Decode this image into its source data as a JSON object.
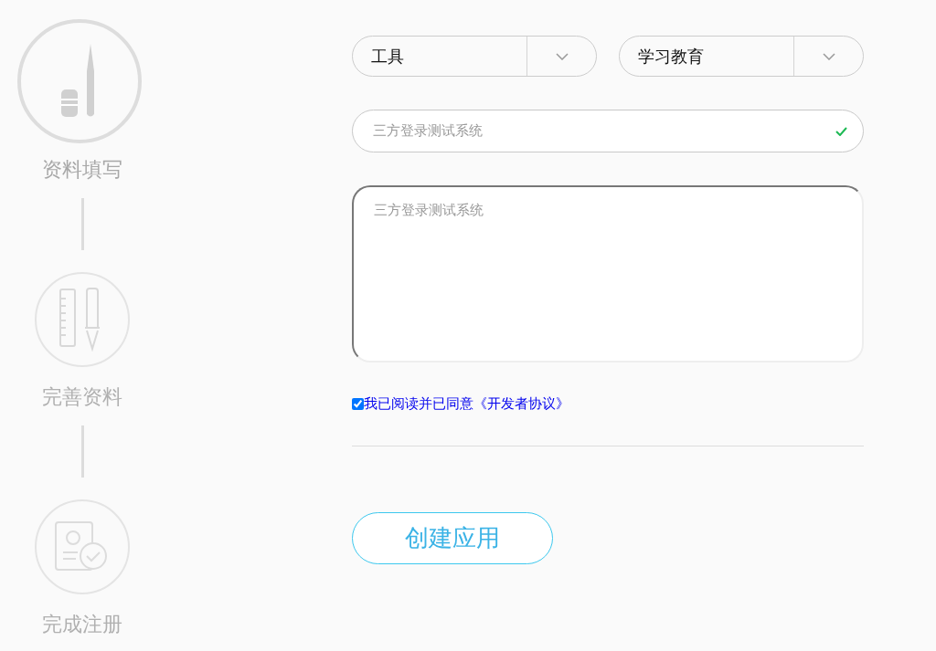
{
  "steps": [
    {
      "label": "资料填写",
      "kind": "pen",
      "selected": true
    },
    {
      "label": "完善资料",
      "kind": "ruler",
      "selected": false
    },
    {
      "label": "完成注册",
      "kind": "document",
      "selected": false
    }
  ],
  "selects": [
    {
      "value": "工具"
    },
    {
      "value": "学习教育"
    }
  ],
  "name_field": {
    "value": "三方登录测试系统",
    "valid": true
  },
  "description": {
    "placeholder": "三方登录测试系统"
  },
  "agreement": {
    "text": "我已阅读并已同意《开发者协议》",
    "checked": true
  },
  "submit": {
    "label": "创建应用"
  }
}
